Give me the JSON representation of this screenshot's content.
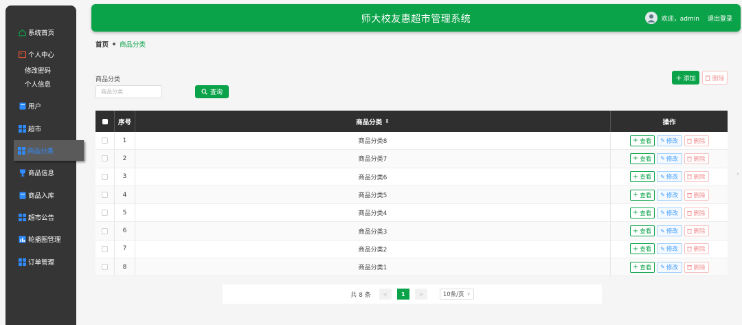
{
  "header": {
    "title": "师大校友惠超市管理系统",
    "welcome": "欢迎，admin",
    "logout": "退出登录"
  },
  "sidebar": {
    "home": "系统首页",
    "personal": "个人中心",
    "change_password": "修改密码",
    "personal_info": "个人信息",
    "users": "用户",
    "supermarket": "超市",
    "category": "商品分类",
    "product_info": "商品信息",
    "stock_in": "商品入库",
    "announcement": "超市公告",
    "carousel": "轮播图管理",
    "orders": "订单管理"
  },
  "breadcrumb": {
    "home": "首页",
    "current": "商品分类"
  },
  "search": {
    "label": "商品分类",
    "placeholder": "商品分类",
    "button": "查询"
  },
  "actions": {
    "add": "添加",
    "delete": "删除"
  },
  "table": {
    "headers": {
      "index": "序号",
      "name": "商品分类",
      "sort_mark": "⇕",
      "ops": "操作"
    },
    "rows": [
      {
        "index": "1",
        "name": "商品分类8"
      },
      {
        "index": "2",
        "name": "商品分类7"
      },
      {
        "index": "3",
        "name": "商品分类6"
      },
      {
        "index": "4",
        "name": "商品分类5"
      },
      {
        "index": "5",
        "name": "商品分类4"
      },
      {
        "index": "6",
        "name": "商品分类3"
      },
      {
        "index": "7",
        "name": "商品分类2"
      },
      {
        "index": "8",
        "name": "商品分类1"
      }
    ],
    "op_labels": {
      "view": "查看",
      "edit": "修改",
      "delete": "删除"
    }
  },
  "pagination": {
    "total": "共 8 条",
    "prev": "<",
    "current": "1",
    "next": ">",
    "page_size": "10条/页"
  },
  "colors": {
    "primary": "#0ba349",
    "sidebar_bg": "#353535",
    "edit_blue": "#409eff",
    "danger": "#f08f8f"
  }
}
